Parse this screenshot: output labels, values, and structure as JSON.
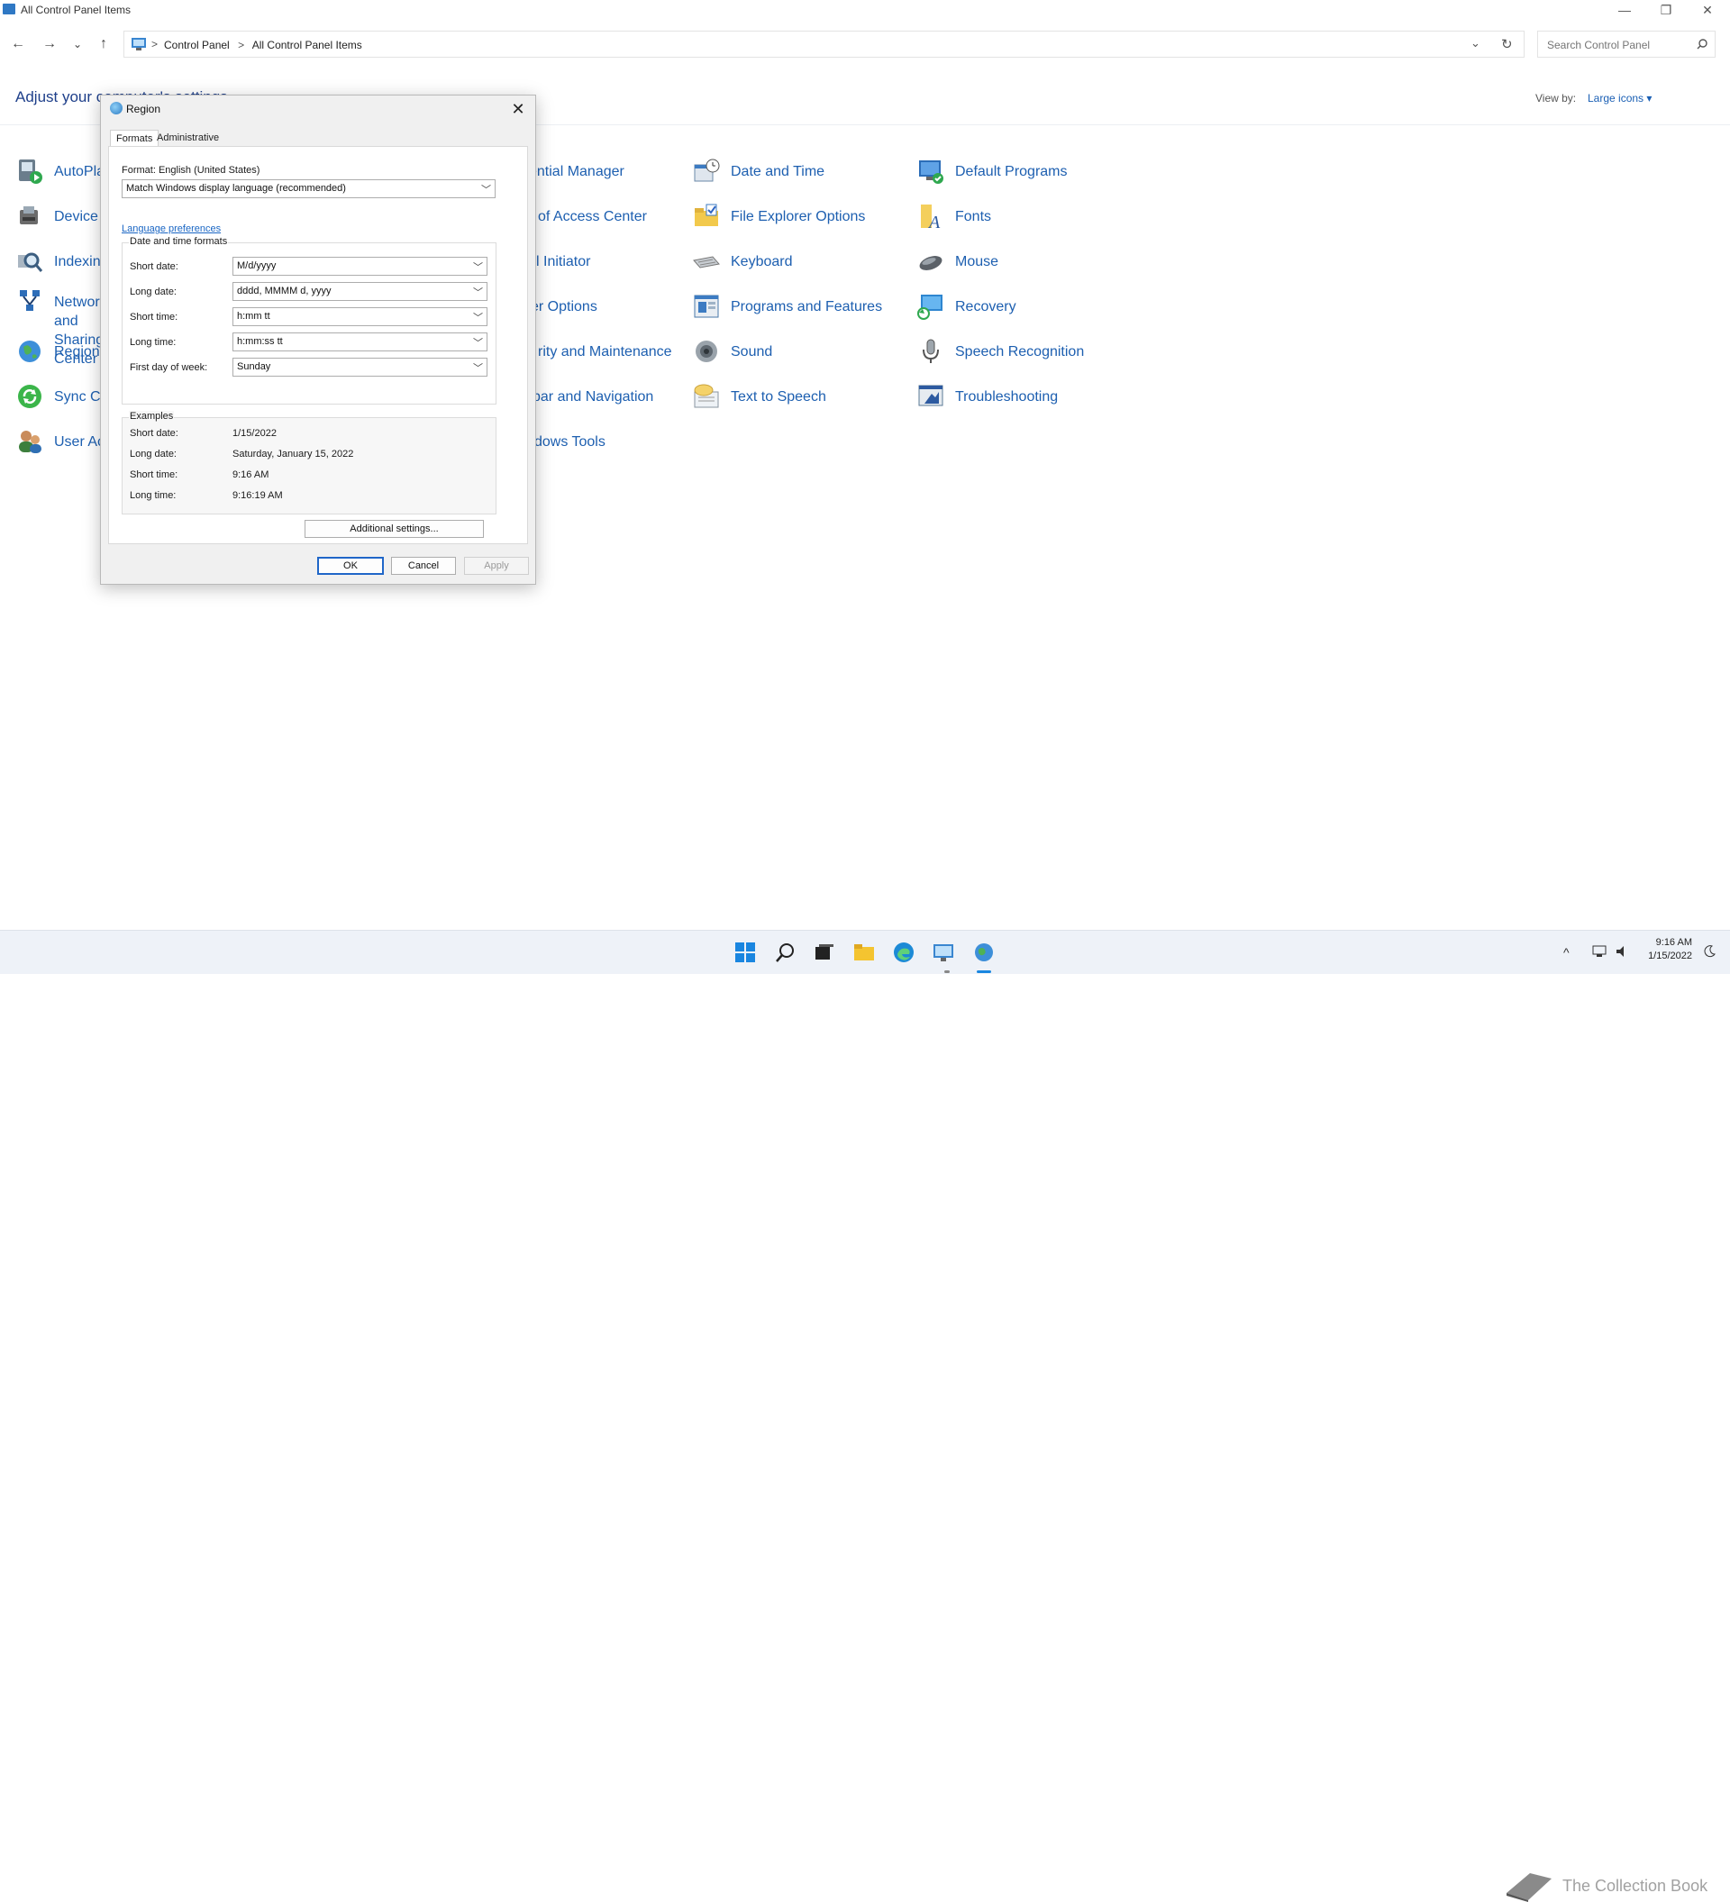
{
  "window": {
    "title": "All Control Panel Items",
    "minimize": "—",
    "restore": "❐",
    "close": "✕"
  },
  "nav": {
    "back": "←",
    "forward": "→",
    "recent": "⌄",
    "up": "↑",
    "breadcrumbs": [
      "Control Panel",
      "All Control Panel Items"
    ],
    "separator": ">",
    "dropdown": "⌄",
    "refresh": "↻",
    "search_placeholder": "Search Control Panel"
  },
  "header": {
    "title": "Adjust your computer's settings",
    "view_by_label": "View by:",
    "view_by_value": "Large icons ▾"
  },
  "items": {
    "col1": [
      {
        "label": "AutoPlay",
        "icon": "autoplay-icon"
      },
      {
        "label": "Device Manager",
        "icon": "device-manager-icon"
      },
      {
        "label": "Indexing Options",
        "icon": "indexing-icon"
      },
      {
        "label": "Network and Sharing Center",
        "icon": "network-icon"
      },
      {
        "label": "Region",
        "icon": "region-icon"
      },
      {
        "label": "Sync Center",
        "icon": "sync-icon"
      },
      {
        "label": "User Accounts",
        "icon": "user-accounts-icon"
      }
    ],
    "col2": [
      {
        "label": "ential Manager"
      },
      {
        "label": "of Access Center"
      },
      {
        "label": "l Initiator"
      },
      {
        "label": "er Options"
      },
      {
        "label": "rity and Maintenance"
      },
      {
        "label": "bar and Navigation"
      },
      {
        "label": "dows Tools"
      }
    ],
    "col3": [
      {
        "label": "Date and Time",
        "icon": "date-time-icon"
      },
      {
        "label": "File Explorer Options",
        "icon": "file-explorer-icon"
      },
      {
        "label": "Keyboard",
        "icon": "keyboard-icon"
      },
      {
        "label": "Programs and Features",
        "icon": "programs-icon"
      },
      {
        "label": "Sound",
        "icon": "sound-icon"
      },
      {
        "label": "Text to Speech",
        "icon": "text-to-speech-icon"
      }
    ],
    "col4": [
      {
        "label": "Default Programs",
        "icon": "default-programs-icon"
      },
      {
        "label": "Fonts",
        "icon": "fonts-icon"
      },
      {
        "label": "Mouse",
        "icon": "mouse-icon"
      },
      {
        "label": "Recovery",
        "icon": "recovery-icon"
      },
      {
        "label": "Speech Recognition",
        "icon": "microphone-icon"
      },
      {
        "label": "Troubleshooting",
        "icon": "troubleshooting-icon"
      }
    ]
  },
  "dialog": {
    "title": "Region",
    "close": "✕",
    "tabs": [
      "Formats",
      "Administrative"
    ],
    "format_label": "Format: English (United States)",
    "format_value": "Match Windows display language (recommended)",
    "language_link": "Language preferences",
    "datetime_group": "Date and time formats",
    "fields": [
      {
        "label": "Short date:",
        "value": "M/d/yyyy"
      },
      {
        "label": "Long date:",
        "value": "dddd, MMMM d, yyyy"
      },
      {
        "label": "Short time:",
        "value": "h:mm tt"
      },
      {
        "label": "Long time:",
        "value": "h:mm:ss tt"
      },
      {
        "label": "First day of week:",
        "value": "Sunday"
      }
    ],
    "examples_group": "Examples",
    "examples": [
      {
        "label": "Short date:",
        "value": "1/15/2022"
      },
      {
        "label": "Long date:",
        "value": "Saturday, January 15, 2022"
      },
      {
        "label": "Short time:",
        "value": "9:16 AM"
      },
      {
        "label": "Long time:",
        "value": "9:16:19 AM"
      }
    ],
    "additional_settings": "Additional settings...",
    "ok": "OK",
    "cancel": "Cancel",
    "apply": "Apply"
  },
  "taskbar": {
    "time": "9:16 AM",
    "date": "1/15/2022",
    "watermark": "The Collection Book",
    "tray_chevron": "^"
  },
  "colors": {
    "accent": "#1a5fb4",
    "link": "#1d5fb0",
    "heading": "#1e3f8a"
  }
}
